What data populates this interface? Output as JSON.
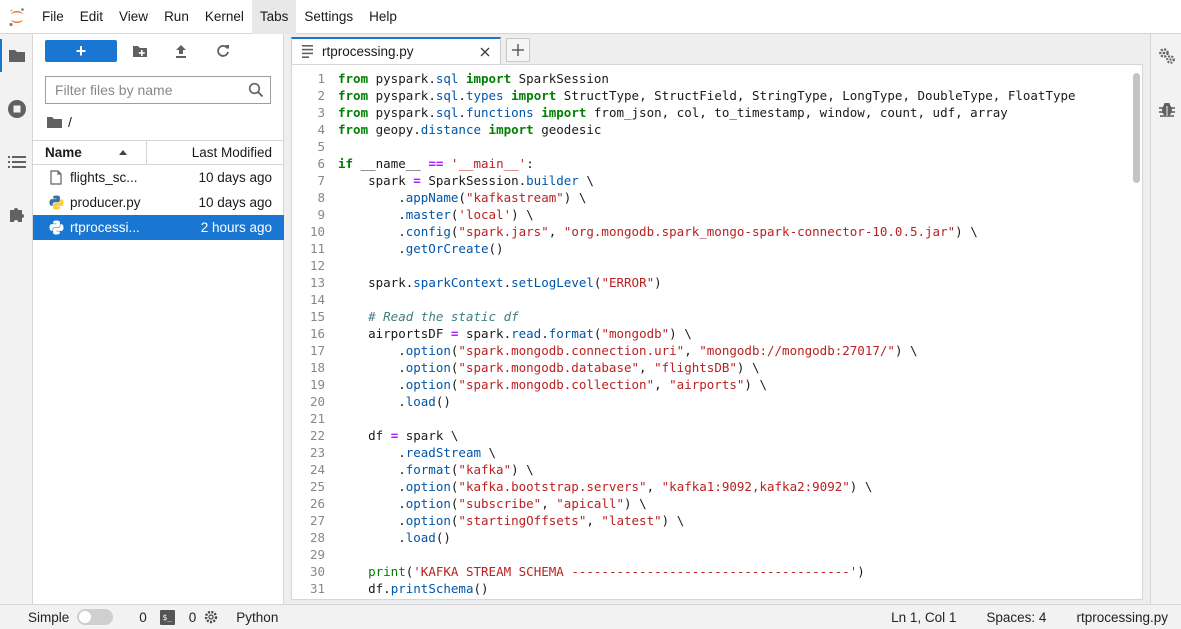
{
  "menubar": {
    "logo_icon": "jupyter-logo-icon",
    "items": [
      "File",
      "Edit",
      "View",
      "Run",
      "Kernel",
      "Tabs",
      "Settings",
      "Help"
    ],
    "active": "Tabs"
  },
  "leftbar": {
    "icons": [
      "folder-icon",
      "running-stop-icon",
      "toc-list-icon",
      "extension-puzzle-icon"
    ],
    "active": "folder-icon"
  },
  "filebrowser": {
    "new_button_label": "+",
    "toolbar_icons": [
      "new-folder-icon",
      "upload-icon",
      "refresh-icon"
    ],
    "filter_placeholder": "Filter files by name",
    "breadcrumb": "/",
    "columns": {
      "name": "Name",
      "modified": "Last Modified"
    },
    "files": [
      {
        "name": "flights_sc...",
        "modified": "10 days ago",
        "icon": "file-icon",
        "selected": false
      },
      {
        "name": "producer.py",
        "modified": "10 days ago",
        "icon": "python-icon",
        "selected": false
      },
      {
        "name": "rtprocessi...",
        "modified": "2 hours ago",
        "icon": "python-icon",
        "selected": true
      }
    ]
  },
  "tabs": [
    {
      "label": "rtprocessing.py",
      "icon": "text-file-icon",
      "active": true
    }
  ],
  "editor": {
    "language": "python",
    "lines": [
      "from pyspark.sql import SparkSession",
      "from pyspark.sql.types import StructType, StructField, StringType, LongType, DoubleType, FloatType",
      "from pyspark.sql.functions import from_json, col, to_timestamp, window, count, udf, array",
      "from geopy.distance import geodesic",
      "",
      "if __name__ == '__main__':",
      "    spark = SparkSession.builder \\",
      "        .appName(\"kafkastream\") \\",
      "        .master('local') \\",
      "        .config(\"spark.jars\", \"org.mongodb.spark_mongo-spark-connector-10.0.5.jar\") \\",
      "        .getOrCreate()",
      "",
      "    spark.sparkContext.setLogLevel(\"ERROR\")",
      "",
      "    # Read the static df",
      "    airportsDF = spark.read.format(\"mongodb\") \\",
      "        .option(\"spark.mongodb.connection.uri\", \"mongodb://mongodb:27017/\") \\",
      "        .option(\"spark.mongodb.database\", \"flightsDB\") \\",
      "        .option(\"spark.mongodb.collection\", \"airports\") \\",
      "        .load()",
      "",
      "    df = spark \\",
      "        .readStream \\",
      "        .format(\"kafka\") \\",
      "        .option(\"kafka.bootstrap.servers\", \"kafka1:9092,kafka2:9092\") \\",
      "        .option(\"subscribe\", \"apicall\") \\",
      "        .option(\"startingOffsets\", \"latest\") \\",
      "        .load()",
      "",
      "    print('KAFKA STREAM SCHEMA -------------------------------------')",
      "    df.printSchema()"
    ],
    "scroll_fraction": 0.21
  },
  "rightbar": {
    "icons": [
      "property-inspector-gear-icon",
      "debugger-bug-icon"
    ]
  },
  "statusbar": {
    "simple_label": "Simple",
    "simple_enabled": false,
    "terminals_count": "0",
    "terminal_icon": "terminal-icon",
    "terminal_glyph": "$_",
    "kernels_count": "0",
    "kernel_icon": "kernel-gear-icon",
    "kernel_name": "Python",
    "cursor": "Ln 1, Col 1",
    "spaces": "Spaces: 4",
    "filename": "rtprocessing.py"
  }
}
